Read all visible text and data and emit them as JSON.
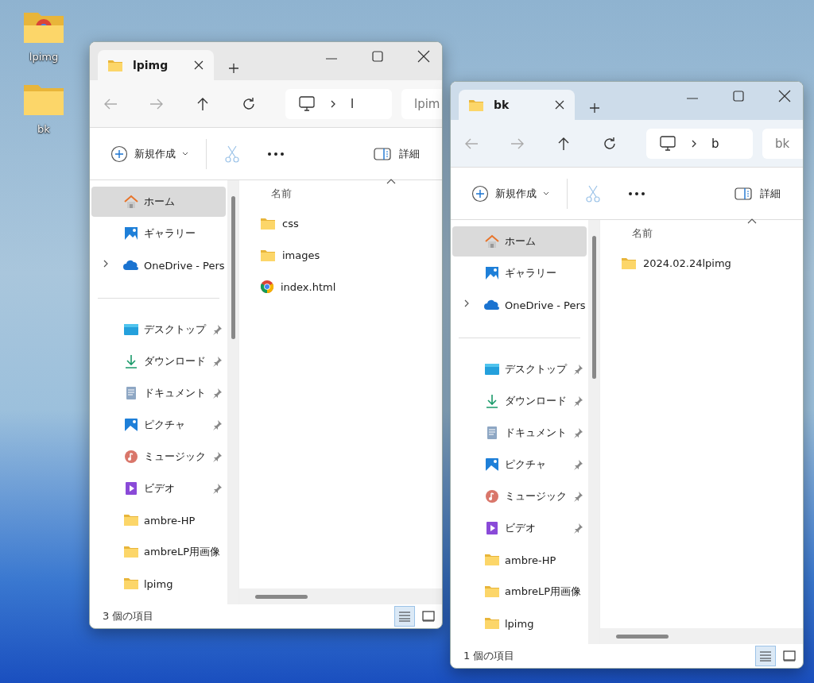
{
  "desktop_icons": [
    {
      "label": "lpimg",
      "kind": "chrome-folder"
    },
    {
      "label": "bk",
      "kind": "folder"
    }
  ],
  "windows": [
    {
      "tab": {
        "title": "lpimg"
      },
      "address": {
        "crumb": "l"
      },
      "search": {
        "placeholder": "lpim"
      },
      "toolbar": {
        "new_label": "新規作成",
        "details_label": "詳細"
      },
      "sidebar": {
        "items": [
          {
            "label": "ホーム",
            "kind": "home",
            "selected": true,
            "pinned": false,
            "expandable": false
          },
          {
            "label": "ギャラリー",
            "kind": "gallery",
            "selected": false,
            "pinned": false,
            "expandable": false
          },
          {
            "label": "OneDrive - Pers",
            "kind": "onedrive",
            "selected": false,
            "pinned": false,
            "expandable": true
          },
          {
            "label": "デスクトップ",
            "kind": "desktop",
            "selected": false,
            "pinned": true,
            "expandable": false,
            "divider_before": true
          },
          {
            "label": "ダウンロード",
            "kind": "download",
            "selected": false,
            "pinned": true,
            "expandable": false
          },
          {
            "label": "ドキュメント",
            "kind": "documents",
            "selected": false,
            "pinned": true,
            "expandable": false
          },
          {
            "label": "ピクチャ",
            "kind": "pictures",
            "selected": false,
            "pinned": true,
            "expandable": false
          },
          {
            "label": "ミュージック",
            "kind": "music",
            "selected": false,
            "pinned": true,
            "expandable": false
          },
          {
            "label": "ビデオ",
            "kind": "videos",
            "selected": false,
            "pinned": true,
            "expandable": false
          },
          {
            "label": "ambre-HP",
            "kind": "folder",
            "selected": false,
            "pinned": false,
            "expandable": false
          },
          {
            "label": "ambreLP用画像",
            "kind": "folder",
            "selected": false,
            "pinned": false,
            "expandable": false
          },
          {
            "label": "lpimg",
            "kind": "folder",
            "selected": false,
            "pinned": false,
            "expandable": false
          }
        ]
      },
      "column_header": "名前",
      "files": [
        {
          "name": "css",
          "kind": "folder"
        },
        {
          "name": "images",
          "kind": "folder"
        },
        {
          "name": "index.html",
          "kind": "chrome"
        }
      ],
      "status": "3 個の項目",
      "view": {
        "details_selected": true
      }
    },
    {
      "tab": {
        "title": "bk"
      },
      "address": {
        "crumb": "b"
      },
      "search": {
        "placeholder": "bk"
      },
      "toolbar": {
        "new_label": "新規作成",
        "details_label": "詳細"
      },
      "sidebar": {
        "items": [
          {
            "label": "ホーム",
            "kind": "home",
            "selected": true,
            "pinned": false,
            "expandable": false
          },
          {
            "label": "ギャラリー",
            "kind": "gallery",
            "selected": false,
            "pinned": false,
            "expandable": false
          },
          {
            "label": "OneDrive - Pers",
            "kind": "onedrive",
            "selected": false,
            "pinned": false,
            "expandable": true
          },
          {
            "label": "デスクトップ",
            "kind": "desktop",
            "selected": false,
            "pinned": true,
            "expandable": false,
            "divider_before": true
          },
          {
            "label": "ダウンロード",
            "kind": "download",
            "selected": false,
            "pinned": true,
            "expandable": false
          },
          {
            "label": "ドキュメント",
            "kind": "documents",
            "selected": false,
            "pinned": true,
            "expandable": false
          },
          {
            "label": "ピクチャ",
            "kind": "pictures",
            "selected": false,
            "pinned": true,
            "expandable": false
          },
          {
            "label": "ミュージック",
            "kind": "music",
            "selected": false,
            "pinned": true,
            "expandable": false
          },
          {
            "label": "ビデオ",
            "kind": "videos",
            "selected": false,
            "pinned": true,
            "expandable": false
          },
          {
            "label": "ambre-HP",
            "kind": "folder",
            "selected": false,
            "pinned": false,
            "expandable": false
          },
          {
            "label": "ambreLP用画像",
            "kind": "folder",
            "selected": false,
            "pinned": false,
            "expandable": false
          },
          {
            "label": "lpimg",
            "kind": "folder",
            "selected": false,
            "pinned": false,
            "expandable": false
          }
        ]
      },
      "column_header": "名前",
      "files": [
        {
          "name": "2024.02.24lpimg",
          "kind": "folder"
        }
      ],
      "status": "1 個の項目",
      "view": {
        "details_selected": true
      }
    }
  ]
}
